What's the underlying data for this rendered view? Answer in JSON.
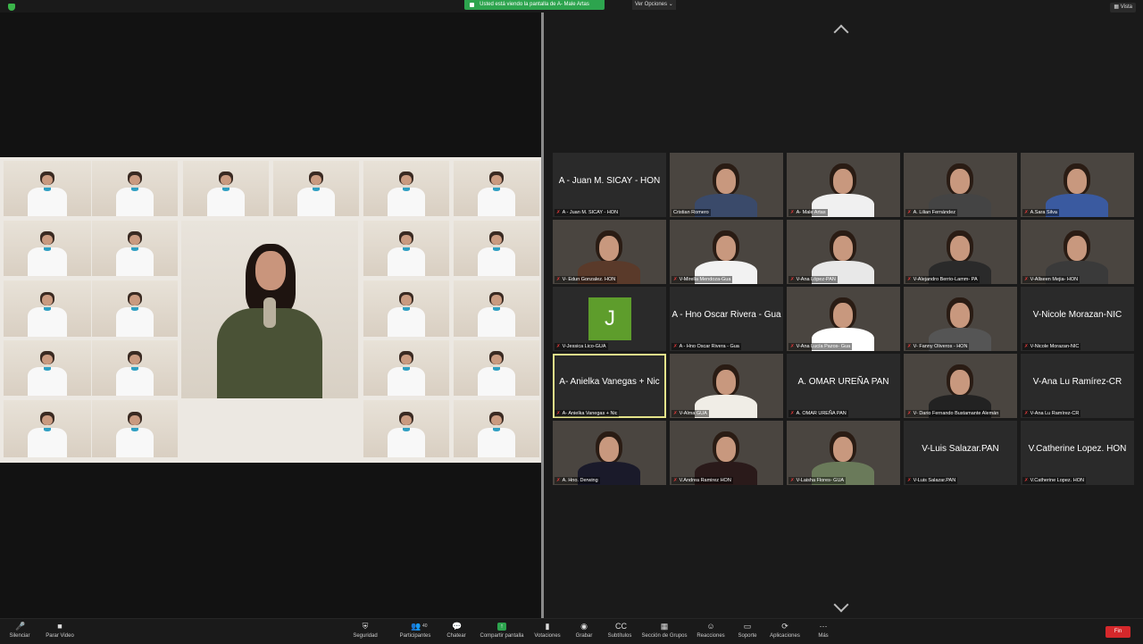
{
  "topbar": {
    "share_banner": "Usted está viendo la pantalla de A- Male Artas",
    "view_options": "Ver Opciones ⌄",
    "view_button": "Vista"
  },
  "colors": {
    "accent_green": "#2da44e",
    "active_speaker": "#e5e48a",
    "end_red": "#d5282b",
    "mute_red": "#e03a3a"
  },
  "participants": [
    {
      "name_big": "A - Juan M. SICAY - HON",
      "label": "A - Juan M. SICAY - HON",
      "video": false,
      "muted": true
    },
    {
      "name_big": "",
      "label": "Cristian Romero",
      "video": true,
      "muted": false,
      "shirt": "#3a4a6a"
    },
    {
      "name_big": "",
      "label": "A- Male Artas",
      "video": true,
      "muted": true,
      "shirt": "#f0f0f0"
    },
    {
      "name_big": "",
      "label": "A. Lilian Fernández",
      "video": true,
      "muted": true,
      "shirt": "#444444"
    },
    {
      "name_big": "",
      "label": "A.Sara Silva",
      "video": true,
      "muted": true,
      "shirt": "#3a5aa0"
    },
    {
      "name_big": "",
      "label": "V- Edun Gonzalez. HON",
      "video": true,
      "muted": true,
      "shirt": "#5a3a2a"
    },
    {
      "name_big": "",
      "label": "V-Mirella Mendoza-Gua",
      "video": true,
      "muted": true,
      "shirt": "#f2f2f2"
    },
    {
      "name_big": "",
      "label": "V-Ana López-PAN",
      "video": true,
      "muted": true,
      "shirt": "#e8e8e8"
    },
    {
      "name_big": "",
      "label": "V-Alejandro Berrio-Lamm- PA",
      "video": true,
      "muted": true,
      "shirt": "#2a2a2a"
    },
    {
      "name_big": "",
      "label": "V-Allseen Mejia- HON",
      "video": true,
      "muted": true,
      "shirt": "#3a3a3a"
    },
    {
      "name_big": "",
      "label": "V-Jessica Lico-GUA",
      "video": false,
      "muted": true,
      "avatar": "J"
    },
    {
      "name_big": "A - Hno Oscar Rivera - Gua",
      "label": "A - Hno Oscar Rivera - Gua",
      "video": false,
      "muted": true
    },
    {
      "name_big": "",
      "label": "V-Ana Lucía Pazos- Gua",
      "video": true,
      "muted": true,
      "shirt": "#ffffff"
    },
    {
      "name_big": "",
      "label": "V- Fanny Oliveros - HON",
      "video": true,
      "muted": true,
      "shirt": "#555555"
    },
    {
      "name_big": "V-Nicole Morazan-NIC",
      "label": "V-Nicole Morazan-NIC",
      "video": false,
      "muted": true
    },
    {
      "name_big": "A- Anielka Vanegas + Nic",
      "label": "A- Anielka Vanegas + Nic",
      "video": false,
      "muted": true,
      "active": true
    },
    {
      "name_big": "",
      "label": "V-Alma GUA",
      "video": true,
      "muted": true,
      "shirt": "#f0ede6"
    },
    {
      "name_big": "A. OMAR UREÑA PAN",
      "label": "A. OMAR UREÑA PAN",
      "video": false,
      "muted": true
    },
    {
      "name_big": "",
      "label": "V- Dario Fernando Bustamante Alemán",
      "video": true,
      "muted": true,
      "shirt": "#222222"
    },
    {
      "name_big": "V-Ana Lu Ramírez-CR",
      "label": "V-Ana Lu Ramírez-CR",
      "video": false,
      "muted": true
    },
    {
      "name_big": "",
      "label": "A. Hno. Derwing",
      "video": true,
      "muted": true,
      "shirt": "#1a1a2a"
    },
    {
      "name_big": "",
      "label": "V.Andrea Ramirez HON",
      "video": true,
      "muted": true,
      "shirt": "#2a1a1a"
    },
    {
      "name_big": "",
      "label": "V-Laisha Flores- GUA",
      "video": true,
      "muted": true,
      "shirt": "#6a7a5a"
    },
    {
      "name_big": "V-Luis Salazar.PAN",
      "label": "V-Luis Salazar.PAN",
      "video": false,
      "muted": true
    },
    {
      "name_big": "V.Catherine Lopez. HON",
      "label": "V.Catherine Lopez. HON",
      "video": false,
      "muted": true
    }
  ],
  "toolbar": {
    "items": [
      {
        "label": "Silenciar",
        "icon": "🎤"
      },
      {
        "label": "Parar Video",
        "icon": "■"
      },
      {
        "label": "Seguridad",
        "icon": "⛨"
      },
      {
        "label": "Participantes",
        "icon": "👥",
        "count": "40"
      },
      {
        "label": "Chatear",
        "icon": "💬"
      },
      {
        "label": "Compartir pantalla",
        "icon": "↑"
      },
      {
        "label": "Votaciones",
        "icon": "▮"
      },
      {
        "label": "Grabar",
        "icon": "◉"
      },
      {
        "label": "Subtítulos",
        "icon": "CC"
      },
      {
        "label": "Sección de Grupos",
        "icon": "▦"
      },
      {
        "label": "Reacciones",
        "icon": "☺"
      },
      {
        "label": "Soporte",
        "icon": "▭"
      },
      {
        "label": "Aplicaciones",
        "icon": "⟳"
      },
      {
        "label": "Más",
        "icon": "⋯"
      }
    ],
    "end_button": "Fin"
  }
}
